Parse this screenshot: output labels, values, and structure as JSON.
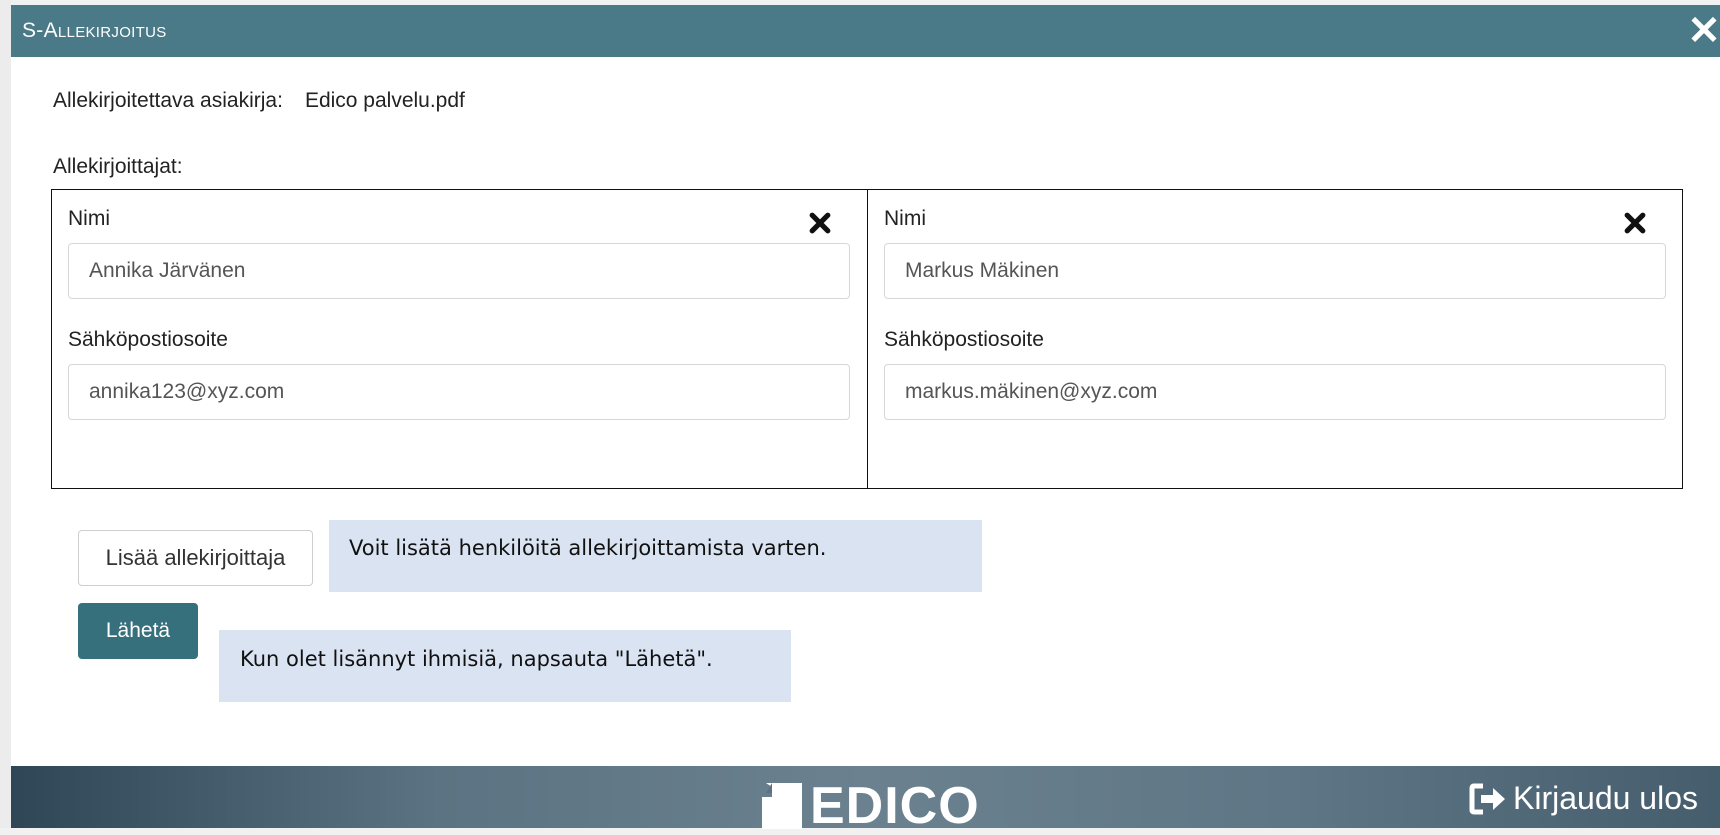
{
  "dialog": {
    "title": "S-Allekirjoitus",
    "close_icon": "close-icon"
  },
  "document": {
    "label": "Allekirjoitettava asiakirja:",
    "name": "Edico palvelu.pdf"
  },
  "signers_label": "Allekirjoittajat:",
  "signers": [
    {
      "name_label": "Nimi",
      "name_value": "Annika Järvänen",
      "email_label": "Sähköpostiosoite",
      "email_value": "annika123@xyz.com",
      "remove_icon": "remove-x-icon"
    },
    {
      "name_label": "Nimi",
      "name_value": "Markus Mäkinen",
      "email_label": "Sähköpostiosoite",
      "email_value": "markus.mäkinen@xyz.com",
      "remove_icon": "remove-x-icon"
    }
  ],
  "buttons": {
    "add_signer": "Lisää allekirjoittaja",
    "send": "Lähetä"
  },
  "hints": {
    "add": "Voit lisätä henkilöitä allekirjoittamista varten.",
    "send": "Kun olet lisännyt ihmisiä, napsauta \"Lähetä\"."
  },
  "footer": {
    "brand": "EDICO",
    "logout": "Kirjaudu ulos",
    "logout_icon": "sign-out-icon"
  },
  "colors": {
    "titlebar": "#4a7a87",
    "primary_button": "#36707d",
    "hint_bg": "#d9e3f2"
  }
}
